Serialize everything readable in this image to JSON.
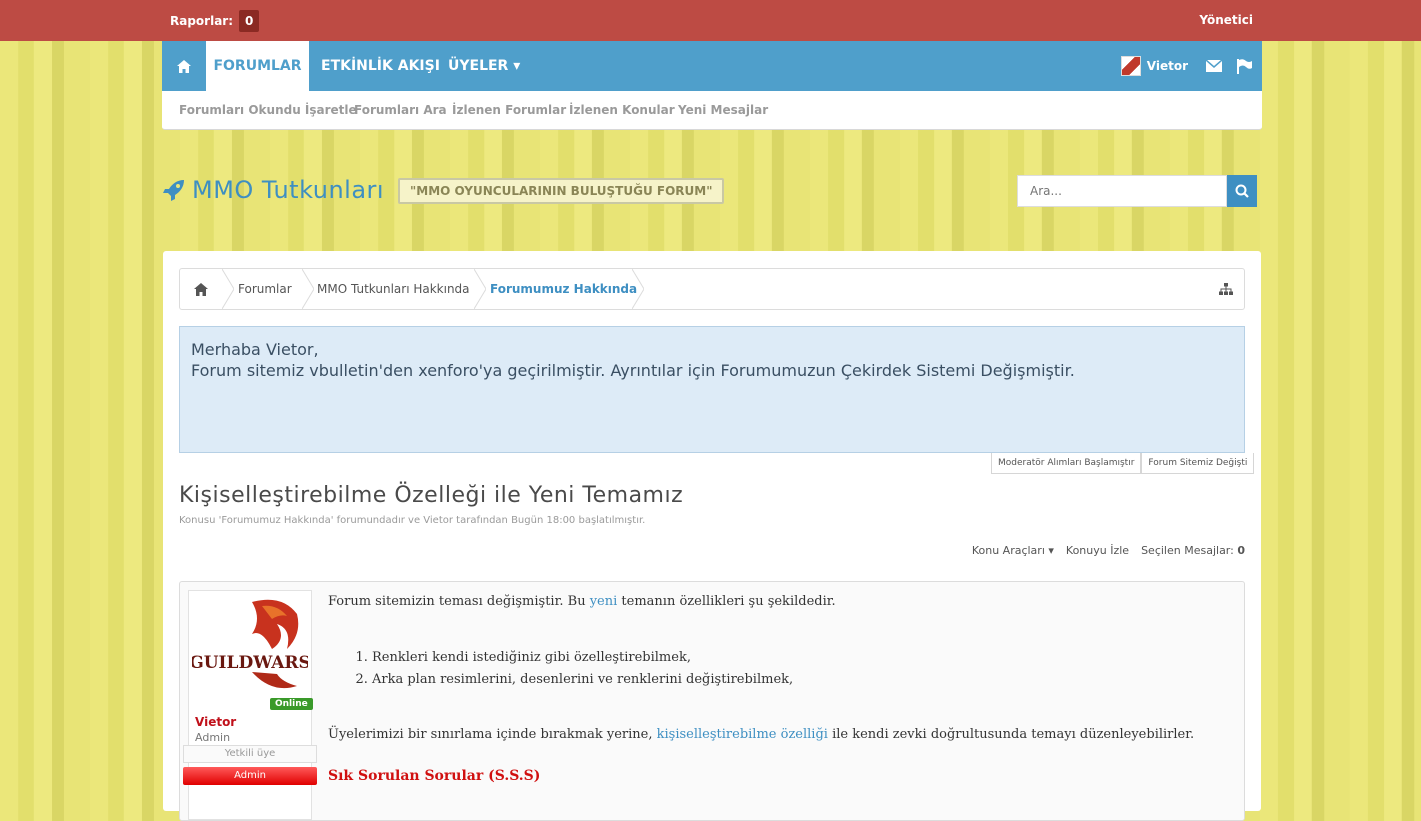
{
  "topbar": {
    "reports_label": "Raporlar:",
    "reports_count": "0",
    "admin_label": "Yönetici"
  },
  "nav": {
    "tabs": [
      "FORUMLAR",
      "ETKİNLİK AKIŞI",
      "ÜYELER ▾"
    ],
    "user_name": "Vietor"
  },
  "subnav": [
    "Forumları Okundu İşaretle",
    "Forumları Ara",
    "İzlenen Forumlar",
    "İzlenen Konular",
    "Yeni Mesajlar"
  ],
  "header": {
    "logo": "MMO Tutkunları",
    "tagline": "\"MMO OYUNCULARININ BULUŞTUĞU FORUM\"",
    "search_placeholder": "Ara..."
  },
  "breadcrumb": [
    "Forumlar",
    "MMO Tutkunları Hakkında",
    "Forumumuz Hakkında"
  ],
  "notice": {
    "greeting": "Merhaba Vietor,",
    "text": "Forum sitemiz vbulletin'den xenforo'ya geçirilmiştir. Ayrıntılar için Forumumuzun Çekirdek Sistemi Değişmiştir.",
    "tabs": [
      "Moderatör Alımları Başlamıştır",
      "Forum Sitemiz Değişti"
    ]
  },
  "thread": {
    "title": "Kişiselleştirebilme Özelleği ile Yeni Temamız",
    "meta": "Konusu 'Forumumuz Hakkında' forumundadır ve Vietor tarafından Bugün 18:00 başlatılmıştır.",
    "tools_menu": "Konu Araçları ▾",
    "watch": "Konuyu İzle",
    "selected_label": "Seçilen Mesajlar:",
    "selected_count": "0"
  },
  "post": {
    "user": {
      "name": "Vietor",
      "title": "Admin",
      "online": "Online",
      "badge1": "Yetkili üye",
      "badge2": "Admin",
      "avatar_text": "GUILDWARS"
    },
    "p1_pre": "Forum sitemizin teması değişmiştir. Bu ",
    "p1_link": "yeni",
    "p1_post": " temanın özellikleri şu şekildedir.",
    "list": [
      "Renkleri kendi istediğiniz gibi özelleştirebilmek,",
      "Arka plan resimlerini, desenlerini ve renklerini değiştirebilmek,"
    ],
    "p2_pre": "Üyelerimizi bir sınırlama içinde bırakmak yerine, ",
    "p2_link": "kişiselleştirebilme özelliği",
    "p2_post": " ile kendi zevki doğrultusunda temayı düzenleyebilirler.",
    "faq": "Sık Sorulan Sorular (S.S.S)"
  }
}
